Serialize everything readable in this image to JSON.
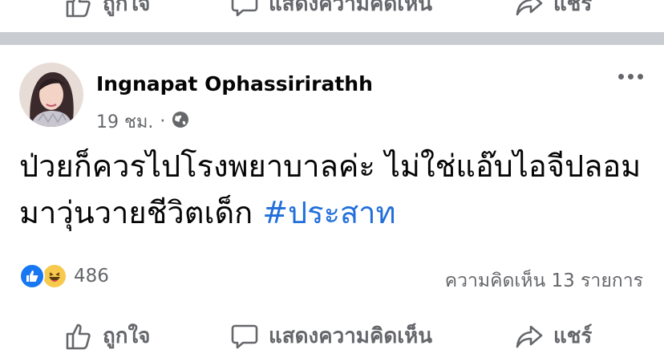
{
  "previous_post": {
    "actions": {
      "like_label": "ถูกใจ",
      "comment_label": "แสดงความคิดเห็น",
      "share_label": "แชร์"
    }
  },
  "post": {
    "author": "Ingnapat Ophassirirathh",
    "timestamp": "19 ชม.",
    "meta_separator": "·",
    "privacy_icon": "globe-icon",
    "text_main": "ป่วยก็ควรไปโรงพยาบาลค่ะ ไม่ใช่แอ๊บไอจีปลอม มาวุ่นวายชีวิตเด็ก ",
    "hashtag": "#ประสาท",
    "reactions": {
      "icons": [
        "like-icon",
        "haha-icon"
      ],
      "count": "486"
    },
    "comment_count": "ความคิดเห็น 13 รายการ",
    "actions": {
      "like_label": "ถูกใจ",
      "comment_label": "แสดงความคิดเห็น",
      "share_label": "แชร์"
    }
  },
  "colors": {
    "hashtag": "#216fdb",
    "secondary_text": "#65676b",
    "divider": "#c9ccd1",
    "like_blue": "#1877f2",
    "haha_yellow": "#f7c94c"
  }
}
